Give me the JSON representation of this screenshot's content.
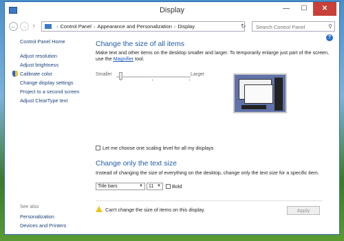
{
  "window": {
    "title": "Display"
  },
  "titlebar": {
    "minimize": "—",
    "maximize": "☐",
    "close": "✕"
  },
  "address": {
    "crumbs": [
      "Control Panel",
      "Appearance and Personalization",
      "Display"
    ],
    "search_placeholder": "Search Control Panel"
  },
  "sidebar": {
    "home": "Control Panel Home",
    "items": [
      "Adjust resolution",
      "Adjust brightness",
      "Calibrate color",
      "Change display settings",
      "Project to a second screen",
      "Adjust ClearType text"
    ],
    "see_also": "See also",
    "see_also_items": [
      "Personalization",
      "Devices and Printers"
    ]
  },
  "main": {
    "size_heading": "Change the size of all items",
    "size_desc_1": "Make text and other items on the desktop smaller and larger. To temporarily enlarge just part of the screen,",
    "size_desc_2_pre": "use the ",
    "size_desc_2_link": "Magnifier",
    "size_desc_2_post": " tool.",
    "slider_smaller": "Smaller",
    "slider_larger": "Larger",
    "slider_level": 0,
    "scaling_checkbox": "Let me choose one scaling level for all my displays",
    "text_heading": "Change only the text size",
    "text_desc": "Instead of changing the size of everything on the desktop, change only the text size for a specific item.",
    "item_select": "Title bars",
    "size_select": "11",
    "bold_label": "Bold",
    "warning": "Can't change the size of items on this display.",
    "apply": "Apply"
  },
  "colors": {
    "heading": "#1e5aa8",
    "link": "#1a3f7a",
    "close": "#c7403a"
  }
}
